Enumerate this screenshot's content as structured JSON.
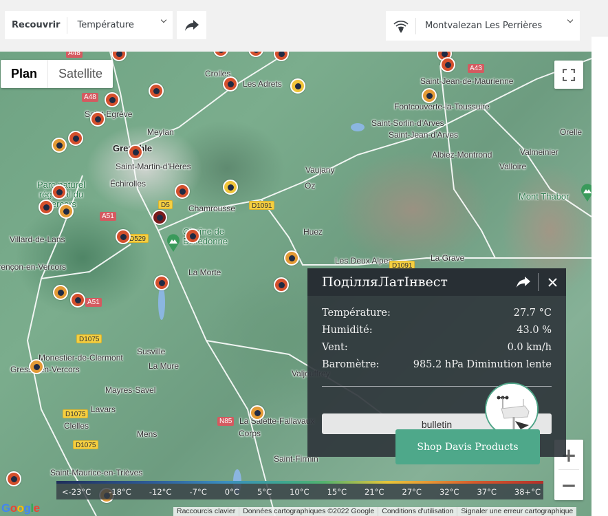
{
  "toolbar": {
    "overlay_label": "Recouvrir",
    "overlay_value": "Température",
    "share_icon": "share-arrow-icon",
    "station_icon": "wifi-location-icon",
    "station_name": "Montvalezan Les Perrières"
  },
  "map": {
    "type_control": {
      "active": "Plan",
      "inactive": "Satellite"
    },
    "fullscreen_icon": "fullscreen-icon",
    "zoom_in": "+",
    "zoom_out": "−",
    "places": [
      "Crolles",
      "Les Adrets",
      "Saint-Egrève",
      "Meylan",
      "Grenoble",
      "Saint-Martin-d'Hères",
      "Échirolles",
      "Chamrousse",
      "Villard-de-Lans",
      "Parc naturel régional du Vercors",
      "Chaîne de Belledonne",
      "La Morte",
      "Vaujany",
      "Oz",
      "Huez",
      "Les Deux Alpes",
      "La Grave",
      "Saint-Jean-de-Maurienne",
      "Fontcouverte-la-Toussuire",
      "Saint-Sorlin-d'Arves",
      "Saint-Jean-d'Arves",
      "Albiez-Montrond",
      "Valmeinier",
      "Valloire",
      "Orelle",
      "Mont Thabor",
      "Corrençon-en-Vercors",
      "Monestier-de-Clermont",
      "Gresse-en-Vercors",
      "Susville",
      "La Mure",
      "Mayres-Savel",
      "Lavars",
      "Clelles",
      "Mens",
      "La Salette-Fallavaux",
      "Corps",
      "Saint-Firmin",
      "Saint-Maurice-en-Trièves",
      "Valjouffrey",
      "Vercors"
    ],
    "roads": [
      "A48",
      "A48",
      "A43",
      "A51",
      "A51",
      "D5",
      "D1091",
      "D1091",
      "D529",
      "D1075",
      "D1075",
      "D1075",
      "N85"
    ]
  },
  "popup": {
    "title": "ПоділляЛатІнвест",
    "rows": [
      {
        "label": "Température:",
        "value": "27.7 °C"
      },
      {
        "label": "Humidité:",
        "value": "43.0 %"
      },
      {
        "label": "Vent:",
        "value": "0.0 km/h"
      },
      {
        "label": "Baromètre:",
        "value": "985.2 hPa Diminution lente"
      }
    ],
    "bulletin_label": "bulletin",
    "shop_button": "Shop Davis Products"
  },
  "legend": {
    "labels": [
      "<-23°C",
      "-18°C",
      "-12°C",
      "-7°C",
      "0°C",
      "5°C",
      "10°C",
      "15°C",
      "21°C",
      "27°C",
      "32°C",
      "37°C",
      "38+°C"
    ],
    "colors": {
      "cold": "#1f2e5a",
      "cool": "#3b8fbf",
      "mild": "#53b26e",
      "warm": "#e7c63a",
      "hot": "#d65a2c",
      "very_hot": "#b5302a"
    }
  },
  "attribution": {
    "logo": "Google",
    "links": [
      "Raccourcis clavier",
      "Données cartographiques ©2022 Google",
      "Conditions d'utilisation",
      "Signaler une erreur cartographique"
    ]
  },
  "marker_colors": {
    "red": "#d4502d",
    "orange": "#e39a36",
    "yellow": "#f0c43a",
    "dark_red": "#7a1c1c"
  }
}
